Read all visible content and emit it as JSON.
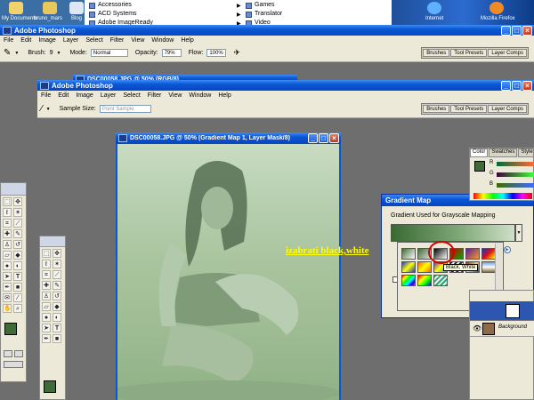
{
  "desktop": {
    "icon_labels": [
      "My Documents",
      "bruno_mars",
      "Blog"
    ],
    "start_menu_left": [
      "Accessories",
      "ACD Systems",
      "Adobe ImageReady"
    ],
    "start_menu_right": [
      "Games",
      "Translator",
      "Video"
    ],
    "tray_icons": [
      "Internet",
      "Mozilla Firefox"
    ]
  },
  "main_window": {
    "title": "Adobe Photoshop",
    "menu": [
      "File",
      "Edit",
      "Image",
      "Layer",
      "Select",
      "Filter",
      "View",
      "Window",
      "Help"
    ],
    "options": {
      "brush_label": "Brush:",
      "brush_value": "9",
      "mode_label": "Mode:",
      "mode_value": "Normal",
      "opacity_label": "Opacity:",
      "opacity_value": "79%",
      "flow_label": "Flow:",
      "flow_value": "100%"
    },
    "well_tabs": [
      "Brushes",
      "Tool Presets",
      "Layer Comps"
    ],
    "behind_doc_title": "DSC00058.JPG @ 50% (RGB/8)"
  },
  "second_window": {
    "title": "Adobe Photoshop",
    "menu": [
      "File",
      "Edit",
      "Image",
      "Layer",
      "Select",
      "Filter",
      "View",
      "Window",
      "Help"
    ],
    "options": {
      "sample_label": "Sample Size:",
      "sample_value": "Point Sample"
    },
    "well_tabs": [
      "Brushes",
      "Tool Presets",
      "Layer Comps"
    ]
  },
  "document": {
    "title": "DSC00058.JPG @ 50% (Gradient Map 1, Layer Mask/8)"
  },
  "annotation": {
    "text": "izabrati black,white",
    "color": "#ffff00"
  },
  "gradient_map": {
    "title": "Gradient Map",
    "group_label": "Gradient Used for Grayscale Mapping",
    "tooltip": "Black, White",
    "gradient_colors": [
      "#3a6a34",
      "#cfe0c8"
    ],
    "highlight_color": "#d40000"
  },
  "color_panel": {
    "tabs": [
      "Color",
      "Swatches",
      "Style"
    ],
    "channels": [
      "R",
      "G",
      "B"
    ]
  },
  "layers_panel": {
    "background_layer": "Background"
  },
  "tools": {
    "foreground_color": "#3f6b38",
    "background_color": "#ffffff"
  }
}
